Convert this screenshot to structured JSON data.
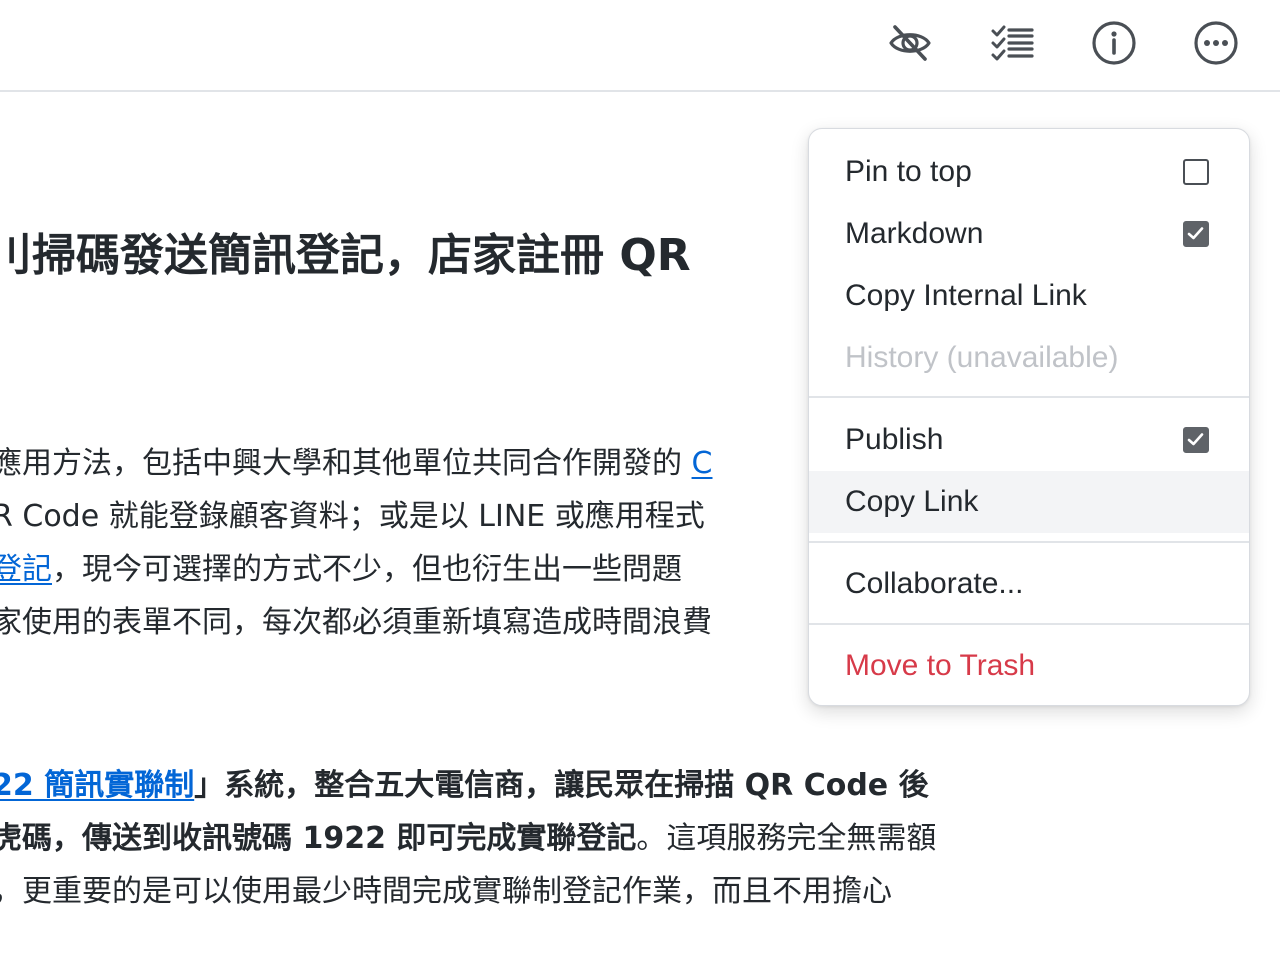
{
  "toolbar": {
    "icons": [
      "eye-slash-icon",
      "checklist-icon",
      "info-icon",
      "more-horizontal-icon"
    ]
  },
  "article": {
    "title": "刂掃碼發送簡訊登記，店家註冊 QR",
    "paragraph1": {
      "line1_text": "應用方法，包括中興大學和其他單位共同合作開發的 ",
      "line1_link": "C",
      "line2_text": "R Code 就能登錄顧客資料；或是以 LINE 或應用程式",
      "line3_link": "登記",
      "line3_text": "，現今可選擇的方式不少，但也衍生出一些問題",
      "line4_text": "家使用的表單不同，每次都必須重新填寫造成時間浪費"
    },
    "paragraph2": {
      "line1_link": "22 簡訊實聯制",
      "line1_text_bold": "」系統，整合五大電信商，讓民眾在掃描 QR Code 後",
      "line2_text_bold": "虎碼，傳送到收訊號碼 1922 即可完成實聯登記",
      "line2_text": "。這項服務完全無需額",
      "line3_text": "，更重要的是可以使用最少時間完成實聯制登記作業，而且不用擔心"
    }
  },
  "menu": {
    "pin_to_top": {
      "label": "Pin to top",
      "checked": false
    },
    "markdown": {
      "label": "Markdown",
      "checked": true
    },
    "copy_internal_link": {
      "label": "Copy Internal Link"
    },
    "history": {
      "label": "History (unavailable)",
      "disabled": true
    },
    "publish": {
      "label": "Publish",
      "checked": true
    },
    "copy_link": {
      "label": "Copy Link",
      "highlighted": true
    },
    "collaborate": {
      "label": "Collaborate..."
    },
    "move_to_trash": {
      "label": "Move to Trash",
      "color": "#d73a49"
    }
  },
  "colors": {
    "link": "#0366d6",
    "danger": "#d73a49",
    "disabled": "#c0c3c8",
    "checkbox_fill": "#5f6368"
  }
}
